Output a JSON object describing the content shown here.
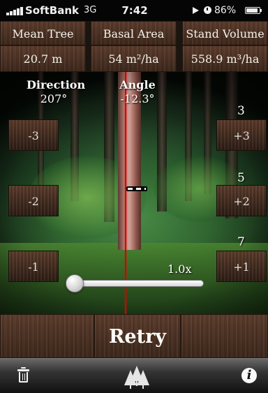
{
  "status_bar": {
    "carrier": "SoftBank",
    "network": "3G",
    "time": "7:42",
    "battery": "86%"
  },
  "stats": {
    "mean_tree_label": "Mean Tree",
    "basal_area_label": "Basal Area",
    "stand_volume_label": "Stand Volume",
    "mean_tree_value": "20.7 m",
    "basal_area_value": "54 m²/ha",
    "stand_volume_value": "558.9 m³/ha"
  },
  "camera": {
    "direction_label": "Direction",
    "direction_value": "207°",
    "angle_label": "Angle",
    "angle_value": "-12.3°",
    "scale_labels": [
      "3",
      "5",
      "7"
    ],
    "left_buttons": [
      "-3",
      "-2",
      "-1"
    ],
    "right_buttons": [
      "+3",
      "+2",
      "+1"
    ],
    "zoom_label": "1.0x",
    "zoom_fraction": 0
  },
  "bottom": {
    "retry_label": "Retry"
  },
  "toolbar": {
    "icons": [
      "trash-icon",
      "trees-icon",
      "info-icon"
    ],
    "info_glyph": "i"
  },
  "colors": {
    "wood": "#4a3123",
    "red_line": "#d40000",
    "text": "#f5f1ea"
  }
}
